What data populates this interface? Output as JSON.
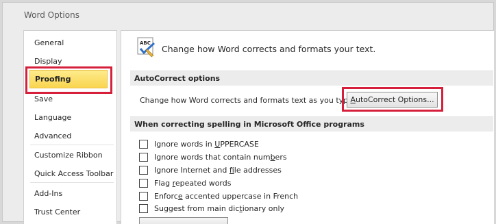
{
  "window": {
    "title": "Word Options"
  },
  "sidebar": {
    "items": [
      {
        "label": "General"
      },
      {
        "label": "Display"
      },
      {
        "label": "Proofing",
        "selected": true
      },
      {
        "label": "Save"
      },
      {
        "label": "Language"
      },
      {
        "label": "Advanced"
      },
      {
        "label": "Customize Ribbon"
      },
      {
        "label": "Quick Access Toolbar"
      },
      {
        "label": "Add-Ins"
      },
      {
        "label": "Trust Center"
      }
    ]
  },
  "main": {
    "header_icon": "abc-check-icon",
    "header": "Change how Word corrects and formats your text.",
    "autocorrect": {
      "section_title": "AutoCorrect options",
      "description": "Change how Word corrects and formats text as you type:",
      "button_label_pre": "",
      "button_label_ul": "A",
      "button_label_post": "utoCorrect Options..."
    },
    "spelling": {
      "section_title": "When correcting spelling in Microsoft Office programs",
      "options": [
        {
          "pre": "Ignore words in ",
          "ul": "U",
          "post": "PPERCASE",
          "checked": false
        },
        {
          "pre": "Ignore words that contain num",
          "ul": "b",
          "post": "ers",
          "checked": false
        },
        {
          "pre": "Ignore Internet and ",
          "ul": "f",
          "post": "ile addresses",
          "checked": false
        },
        {
          "pre": "Flag ",
          "ul": "r",
          "post": "epeated words",
          "checked": false
        },
        {
          "pre": "Enforc",
          "ul": "e",
          "post": " accented uppercase in French",
          "checked": false
        },
        {
          "pre": "Suggest from main dic",
          "ul": "t",
          "post": "ionary only",
          "checked": false
        }
      ]
    }
  },
  "colors": {
    "highlight_border": "#d6203b",
    "selected_fill": "#fad54f"
  }
}
